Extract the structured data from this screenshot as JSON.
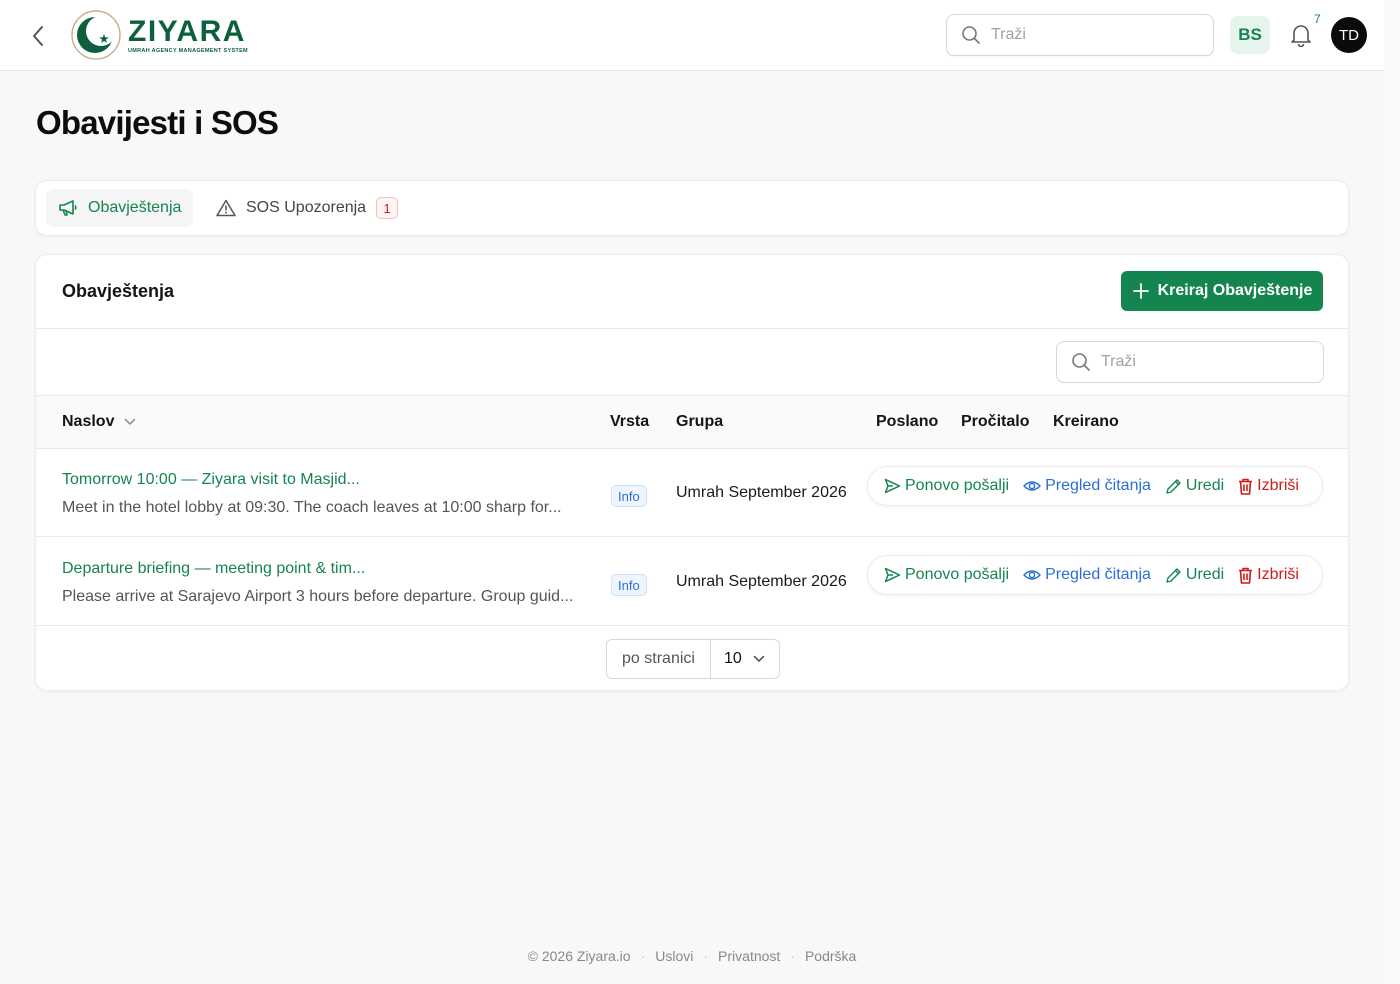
{
  "header": {
    "logo_name": "ZIYARA",
    "logo_subtitle": "UMRAH AGENCY MANAGEMENT SYSTEM",
    "search_placeholder": "Traži",
    "language": "BS",
    "notification_count": "7",
    "avatar_initials": "TD"
  },
  "page": {
    "title": "Obavijesti i SOS"
  },
  "tabs": [
    {
      "label": "Obavještenja",
      "active": true
    },
    {
      "label": "SOS Upozorenja",
      "badge": "1",
      "active": false
    }
  ],
  "card": {
    "title": "Obavještenja",
    "create_label": "Kreiraj Obavještenje",
    "search_placeholder": "Traži"
  },
  "table": {
    "columns": {
      "title": "Naslov",
      "type": "Vrsta",
      "group": "Grupa",
      "sent": "Poslano",
      "read": "Pročitalo",
      "created": "Kreirano"
    },
    "rows": [
      {
        "title": "Tomorrow 10:00 — Ziyara visit to Masjid...",
        "description": "Meet in the hotel lobby at 09:30. The coach leaves at 10:00 sharp for...",
        "type": "Info",
        "group": "Umrah September 2026"
      },
      {
        "title": "Departure briefing — meeting point & tim...",
        "description": "Please arrive at Sarajevo Airport 3 hours before departure. Group guid...",
        "type": "Info",
        "group": "Umrah September 2026"
      }
    ],
    "actions": {
      "resend": "Ponovo pošalji",
      "read_overview": "Pregled čitanja",
      "edit": "Uredi",
      "delete": "Izbriši"
    }
  },
  "pagination": {
    "per_page_label": "po stranici",
    "per_page_value": "10"
  },
  "footer": {
    "copyright": "© 2026 Ziyara.io",
    "links": [
      "Uslovi",
      "Privatnost",
      "Podrška"
    ]
  },
  "colors": {
    "brand": "#15854f",
    "link_blue": "#2b6fd6",
    "danger": "#d11a1a",
    "logo_dark": "#0e5f3c"
  }
}
